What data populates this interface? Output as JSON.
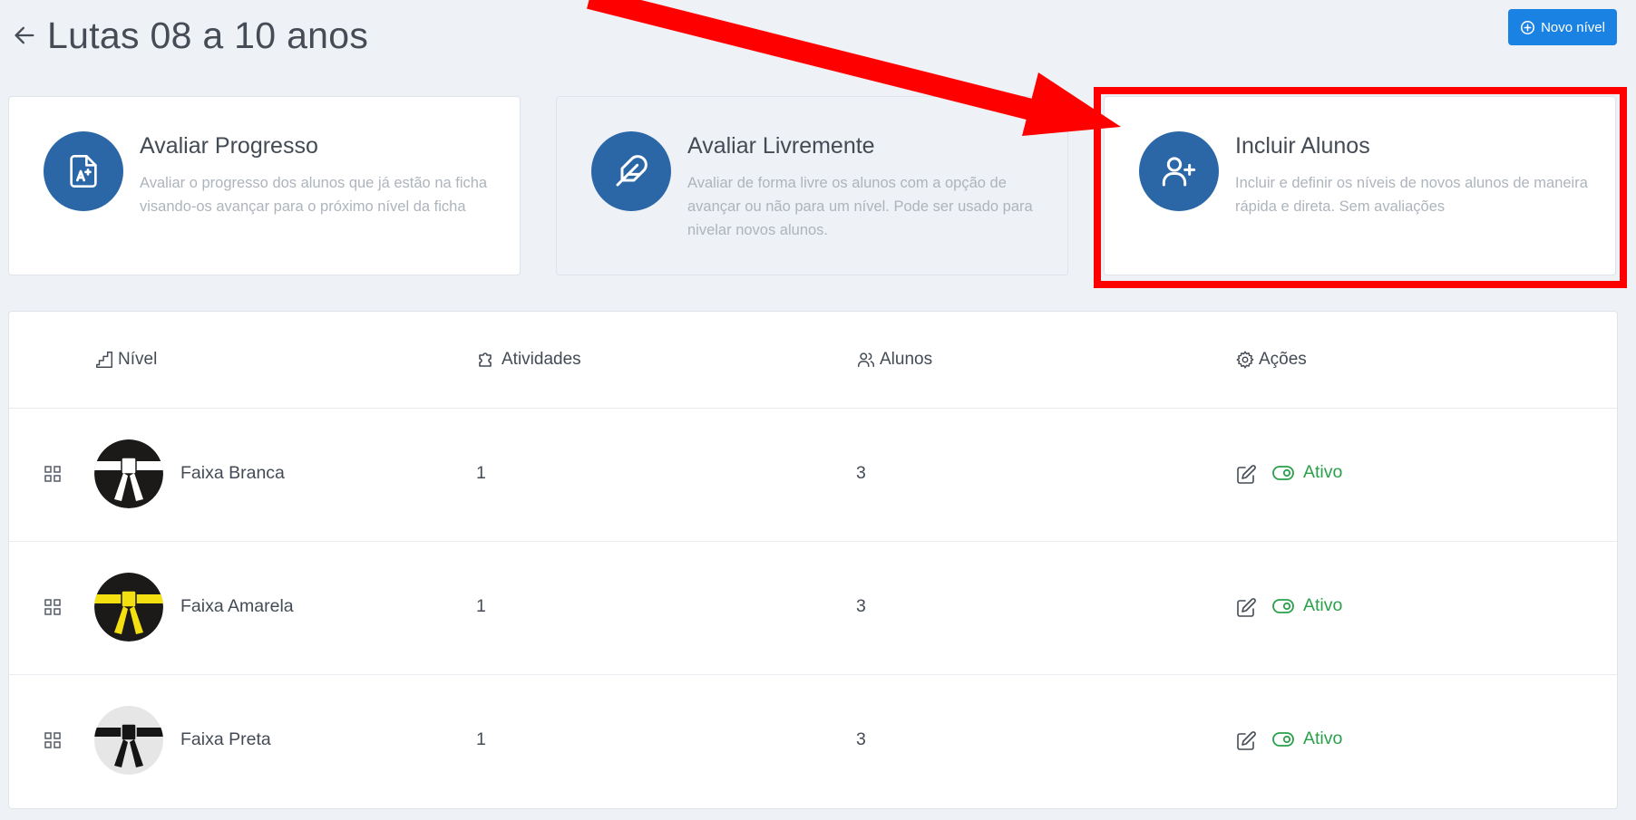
{
  "page": {
    "title": "Lutas 08 a 10 anos"
  },
  "toolbar": {
    "new_level_label": "Novo nível"
  },
  "cards": [
    {
      "title": "Avaliar Progresso",
      "description": "Avaliar o progresso dos alunos que já estão na ficha visando-os avançar para o próximo nível da ficha",
      "icon": "graded-paper-icon"
    },
    {
      "title": "Avaliar Livremente",
      "description": "Avaliar de forma livre os alunos com a opção de avançar ou não para um nível. Pode ser usado para nivelar novos alunos.",
      "icon": "feather-icon"
    },
    {
      "title": "Incluir Alunos",
      "description": "Incluir e definir os níveis de novos alunos de maneira rápida e direta. Sem avaliações",
      "icon": "add-user-icon"
    }
  ],
  "table": {
    "headers": {
      "level": "Nível",
      "activities": "Atividades",
      "students": "Alunos",
      "actions": "Ações"
    },
    "rows": [
      {
        "name": "Faixa Branca",
        "activities": "1",
        "students": "3",
        "status": "Ativo",
        "belt_color": "#ffffff",
        "bg_color": "#1c1a19"
      },
      {
        "name": "Faixa Amarela",
        "activities": "1",
        "students": "3",
        "status": "Ativo",
        "belt_color": "#f4e010",
        "bg_color": "#1c1a19"
      },
      {
        "name": "Faixa Preta",
        "activities": "1",
        "students": "3",
        "status": "Ativo",
        "belt_color": "#151515",
        "bg_color": "#e6e6e6"
      }
    ]
  },
  "colors": {
    "primary": "#1a82e2",
    "icon_circle": "#2b66a7",
    "active": "#2aa04a",
    "highlight": "#ff0000"
  }
}
